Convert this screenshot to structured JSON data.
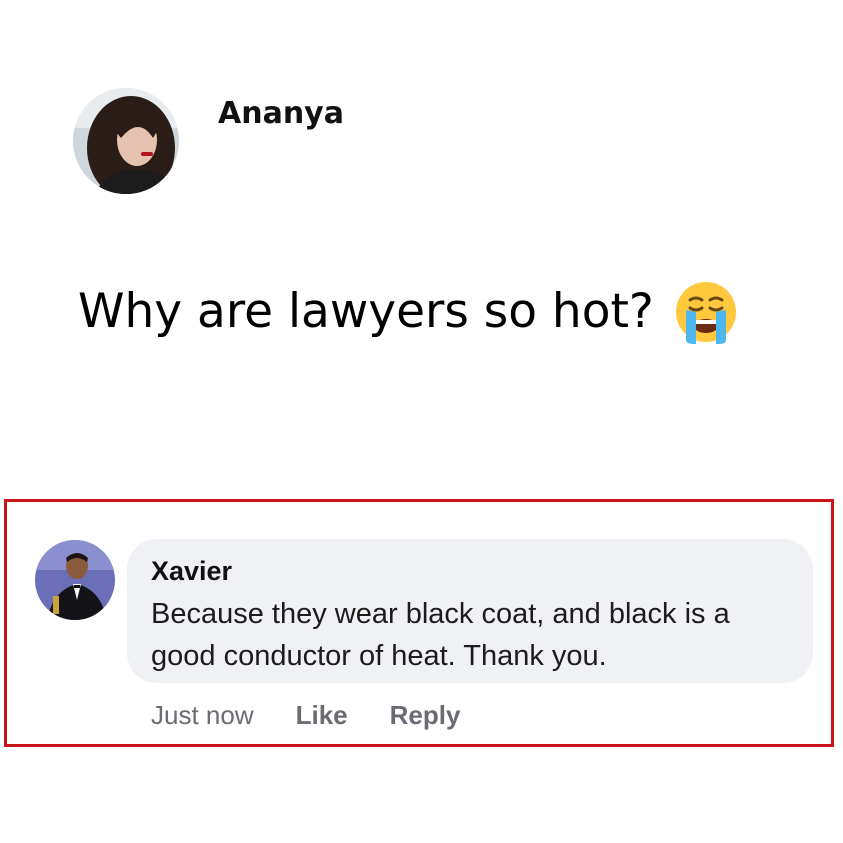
{
  "post": {
    "author_name": "Ananya",
    "avatar_icon": "profile-photo-avatar",
    "text": "Why are lawyers so hot?",
    "emoji_icon": "loudly-crying-face-emoji"
  },
  "comment": {
    "highlight_color": "#c8141b",
    "author_name": "Xavier",
    "avatar_icon": "profile-photo-avatar",
    "text": "Because they wear black coat, and black is a good conductor of heat. Thank you.",
    "timestamp": "Just now",
    "like_label": "Like",
    "reply_label": "Reply"
  }
}
